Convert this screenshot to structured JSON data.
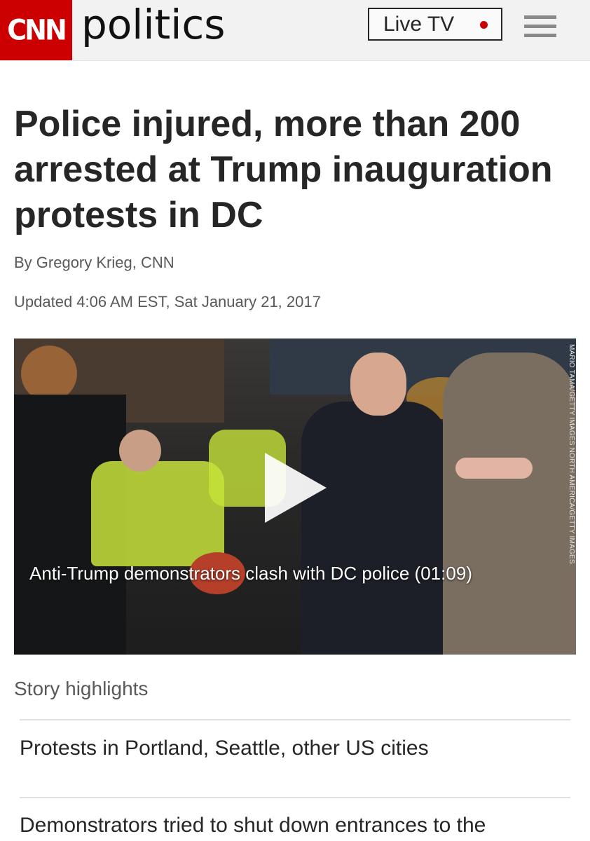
{
  "header": {
    "logo_text": "CNN",
    "section": "politics",
    "live_tv_label": "Live TV",
    "brand_color": "#cc0000"
  },
  "article": {
    "headline": "Police injured, more than 200 arrested at Trump inauguration protests in DC",
    "byline": "By Gregory Krieg, CNN",
    "updated": "Updated 4:06 AM EST, Sat January 21, 2017"
  },
  "video": {
    "caption": "Anti-Trump demonstrators clash with DC police (01:09)",
    "photo_credit": "MARIO TAMA/GETTY IMAGES NORTH AMERICA/GETTY IMAGES",
    "play_icon": "play-icon"
  },
  "highlights": {
    "title": "Story highlights",
    "items": [
      "Protests in Portland, Seattle, other US cities",
      "Demonstrators tried to shut down entrances to the"
    ]
  }
}
